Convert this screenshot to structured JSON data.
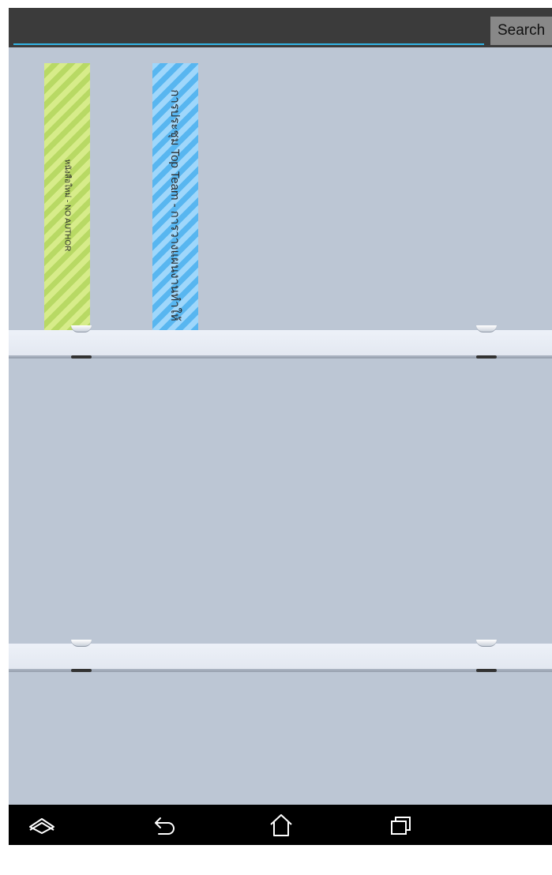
{
  "search": {
    "value": "",
    "placeholder": "",
    "button_label": "Search"
  },
  "books": [
    {
      "title": "หนังสือใหม่ - NO AUTHOR",
      "color": "#c3e173"
    },
    {
      "title": "การประชุม Top Team - การวางแผนงานทำให้",
      "color": "#6ec3f5"
    }
  ],
  "navbar": {
    "buttons": [
      {
        "icon": "collapse-icon"
      },
      {
        "icon": "back-icon"
      },
      {
        "icon": "home-icon"
      },
      {
        "icon": "recent-apps-icon"
      }
    ]
  },
  "colors": {
    "background": "#bcc6d4",
    "topbar": "#3b3b3b",
    "accent": "#33b5e5"
  }
}
